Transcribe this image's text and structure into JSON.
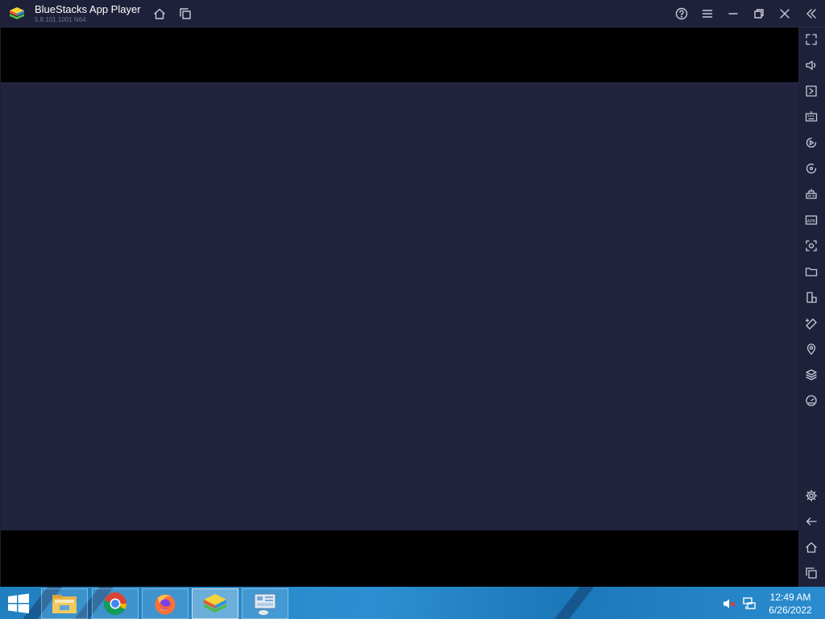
{
  "window": {
    "title": "BlueStacks App Player",
    "version": "5.8.101.1001 N64"
  },
  "titlebar_buttons": [
    {
      "name": "home-icon"
    },
    {
      "name": "multi-instance-icon"
    },
    {
      "name": "help-icon"
    },
    {
      "name": "menu-icon"
    },
    {
      "name": "minimize-icon"
    },
    {
      "name": "restore-icon"
    },
    {
      "name": "close-icon"
    },
    {
      "name": "collapse-sidebar-icon"
    }
  ],
  "sidebar": {
    "tools": [
      "fullscreen-icon",
      "volume-icon",
      "media-manager-icon",
      "keyboard-controls-icon",
      "macro-recorder-icon",
      "rotate-icon",
      "gamepad-icon",
      "install-apk-icon",
      "screenshot-icon",
      "folder-icon",
      "device-rotate-icon",
      "eco-mode-icon",
      "location-icon",
      "layers-icon",
      "performance-icon"
    ],
    "bottom": [
      "settings-icon",
      "back-icon",
      "android-home-icon",
      "recent-apps-icon"
    ],
    "apk_badge": "APK"
  },
  "taskbar": {
    "apps": [
      {
        "name": "file-explorer-icon"
      },
      {
        "name": "chrome-icon"
      },
      {
        "name": "firefox-icon"
      },
      {
        "name": "bluestacks-icon",
        "active": true
      },
      {
        "name": "multi-instance-manager-icon"
      }
    ],
    "clock": {
      "time": "12:49 AM",
      "date": "6/26/2022"
    },
    "tray": [
      "volume-muted-icon",
      "network-icon"
    ]
  },
  "colors": {
    "titlebar_bg": "#1e2139",
    "screen_bg": "#22243f",
    "icon": "#c9cbdb",
    "taskbar": "#2d8fd1"
  }
}
